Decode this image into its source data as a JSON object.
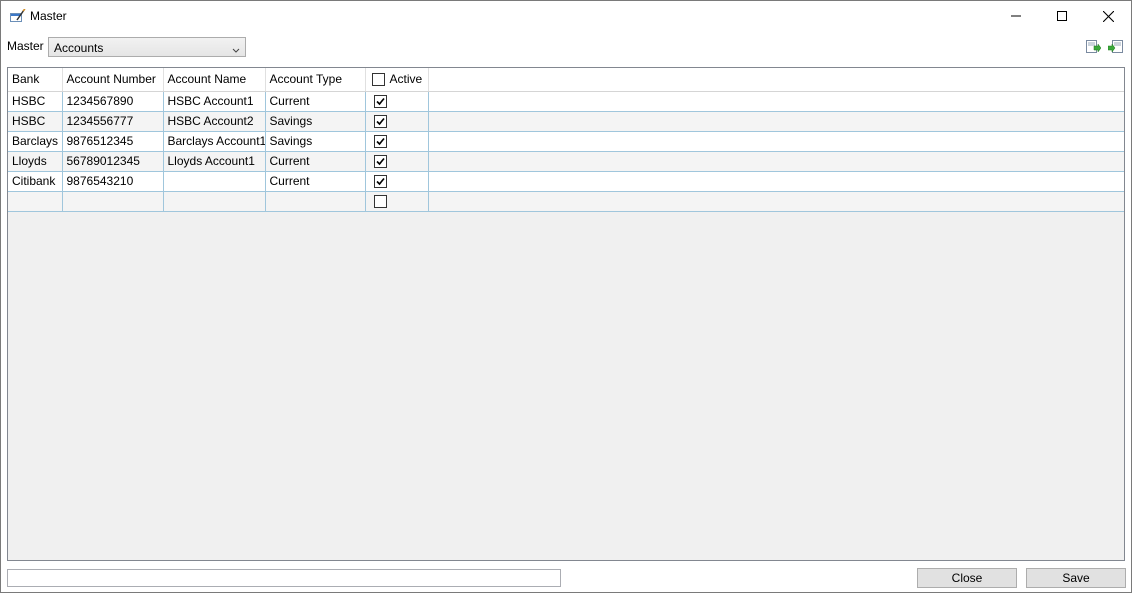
{
  "window": {
    "title": "Master"
  },
  "master": {
    "label": "Master",
    "selected": "Accounts"
  },
  "grid": {
    "columns": [
      "Bank",
      "Account Number",
      "Account Name",
      "Account Type",
      "Active"
    ],
    "rows": [
      {
        "bank": "HSBC",
        "account_number": "1234567890",
        "account_name": "HSBC Account1",
        "account_type": "Current",
        "active": true
      },
      {
        "bank": "HSBC",
        "account_number": "1234556777",
        "account_name": "HSBC Account2",
        "account_type": "Savings",
        "active": true
      },
      {
        "bank": "Barclays",
        "account_number": "9876512345",
        "account_name": "Barclays Account1",
        "account_type": "Savings",
        "active": true
      },
      {
        "bank": "Lloyds",
        "account_number": "56789012345",
        "account_name": "Lloyds Account1",
        "account_type": "Current",
        "active": true
      },
      {
        "bank": "Citibank",
        "account_number": "9876543210",
        "account_name": "",
        "account_type": "Current",
        "active": true
      },
      {
        "bank": "",
        "account_number": "",
        "account_name": "",
        "account_type": "",
        "active": false
      }
    ]
  },
  "footer": {
    "status_value": "",
    "close_label": "Close",
    "save_label": "Save"
  },
  "icons": {
    "app": "app-window-icon",
    "minimize": "minimize-icon",
    "maximize": "maximize-icon",
    "close": "close-icon",
    "import": "import-icon",
    "export": "export-icon",
    "dropdown": "chevron-down-icon"
  }
}
